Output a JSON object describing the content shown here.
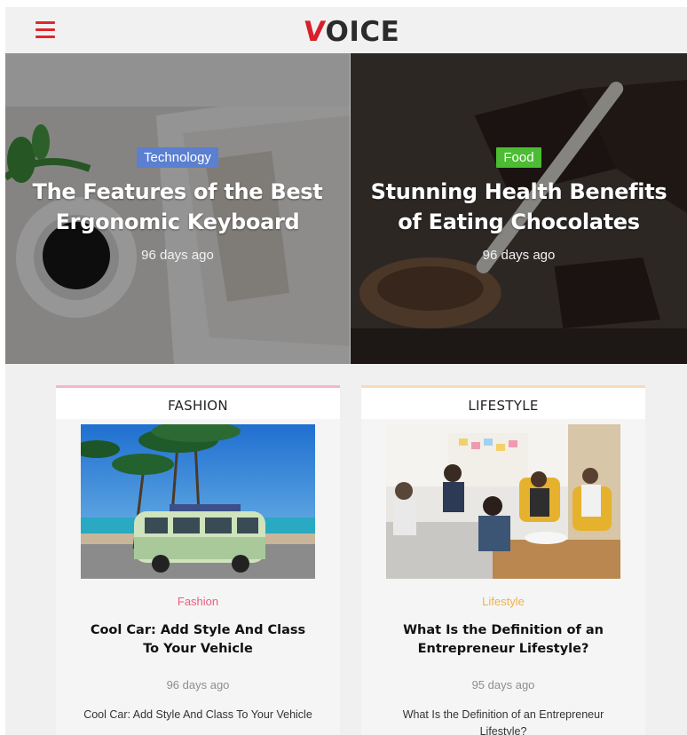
{
  "header": {
    "logo": {
      "first_letter": "V",
      "rest": "OICE"
    },
    "menu_icon": "hamburger-menu-icon",
    "colors": {
      "brand_red": "#e0262b"
    }
  },
  "hero": {
    "articles": [
      {
        "category": "Technology",
        "category_color": "#5b7fd1",
        "title": "The Features of the Best Ergonomic Keyboard",
        "date": "96 days ago"
      },
      {
        "category": "Food",
        "category_color": "#4cbc32",
        "title": "Stunning Health Benefits of Eating Chocolates",
        "date": "96 days ago"
      }
    ]
  },
  "sections": [
    {
      "heading": "FASHION",
      "category": "Fashion",
      "category_color": "#e8607f",
      "title": "Cool Car: Add Style And Class To Your Vehicle",
      "date": "96 days ago",
      "excerpt": "Cool Car: Add Style And Class To Your Vehicle"
    },
    {
      "heading": "LIFESTYLE",
      "category": "Lifestyle",
      "category_color": "#f1b14c",
      "title": "What Is the Definition of an Entrepreneur Lifestyle?",
      "date": "95 days ago",
      "excerpt": "What Is the Definition of an Entrepreneur Lifestyle?"
    }
  ]
}
